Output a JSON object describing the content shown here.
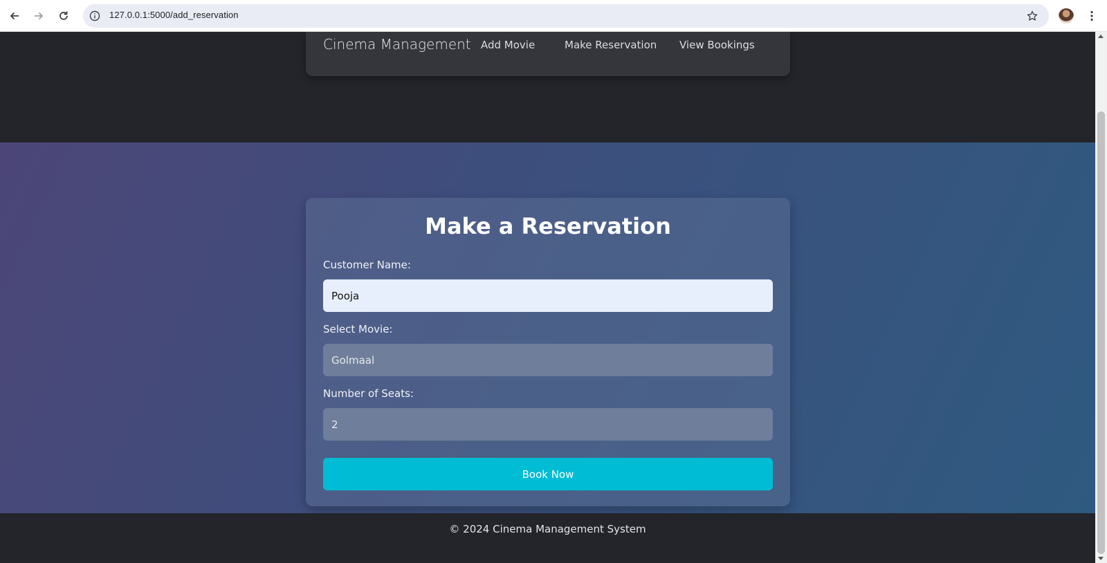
{
  "browser": {
    "url": "127.0.0.1:5000/add_reservation",
    "icons": {
      "back": "back-arrow-icon",
      "forward": "forward-arrow-icon",
      "reload": "reload-icon",
      "info": "info-icon",
      "bookmark": "star-icon",
      "menu": "kebab-menu-icon"
    }
  },
  "navbar": {
    "brand": "Cinema Management",
    "links": [
      "Add Movie",
      "Make Reservation",
      "View Bookings"
    ]
  },
  "form": {
    "title": "Make a Reservation",
    "customer_label": "Customer Name:",
    "customer_value": "Pooja",
    "movie_label": "Select Movie:",
    "movie_value": "Golmaal",
    "seats_label": "Number of Seats:",
    "seats_value": "2",
    "submit_label": "Book Now"
  },
  "footer": {
    "text": "© 2024 Cinema Management System"
  },
  "colors": {
    "header_bg": "#23252b",
    "navbar_bg": "#34363c",
    "accent": "#00bcd4",
    "gradient_start": "#4c4678",
    "gradient_end": "#2f5a80"
  }
}
